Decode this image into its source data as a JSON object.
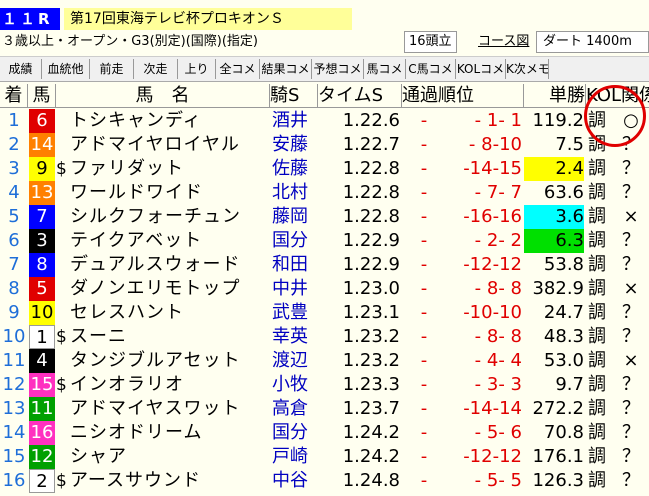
{
  "header": {
    "race_no": "１１R",
    "race_title": "第17回東海テレビ杯プロキオンＳ",
    "conditions": "３歳以上・オープン・G3(別定)(国際)(指定)",
    "heads": "16頭立",
    "course_link": "コース図",
    "track": "ダート 1400m"
  },
  "buttons": [
    "成績",
    "血統他",
    "前走",
    "次走",
    "上り",
    "全コメ",
    "結果コメ",
    "予想コメ",
    "馬コメ",
    "C馬コメ",
    "KOLコメ",
    "K次メモ"
  ],
  "columns": {
    "chaku": "着",
    "uma": "馬",
    "name": "馬　名",
    "jockey": "騎S",
    "time": "タイムS",
    "pass": "通過順位",
    "odds": "単勝",
    "kol": "KOL関係"
  },
  "colors": {
    "waku1": "#ffffff",
    "waku2": "#000000",
    "waku3": "#e00000",
    "waku4": "#0000ff",
    "waku5": "#ffff00",
    "waku6": "#00a000",
    "waku7": "#ff8000",
    "waku8": "#ff30c0",
    "fav1": "#ffff00",
    "fav2": "#00ffff",
    "fav3": "#00e000",
    "accent": "#e00000"
  },
  "rows": [
    {
      "chaku": "1",
      "waku": "3",
      "uma": "6",
      "mark": "",
      "name": "トシキャンディ",
      "jockey": "酒井",
      "time": "1.22.6",
      "dash": "-",
      "pass": "- 1- 1",
      "odds": "119.2",
      "cho": "調",
      "kol": "○",
      "fav": ""
    },
    {
      "chaku": "2",
      "waku": "7",
      "uma": "14",
      "mark": "",
      "name": "アドマイヤロイヤル",
      "jockey": "安藤",
      "time": "1.22.7",
      "dash": "-",
      "pass": "- 8-10",
      "odds": "7.5",
      "cho": "調",
      "kol": "？",
      "fav": ""
    },
    {
      "chaku": "3",
      "waku": "5",
      "uma": "9",
      "mark": "$",
      "name": "ファリダット",
      "jockey": "佐藤",
      "time": "1.22.8",
      "dash": "-",
      "pass": "-14-15",
      "odds": "2.4",
      "cho": "調",
      "kol": "？",
      "fav": "fav1"
    },
    {
      "chaku": "4",
      "waku": "7",
      "uma": "13",
      "mark": "",
      "name": "ワールドワイド",
      "jockey": "北村",
      "time": "1.22.8",
      "dash": "-",
      "pass": "- 7- 7",
      "odds": "63.6",
      "cho": "調",
      "kol": "？",
      "fav": ""
    },
    {
      "chaku": "5",
      "waku": "4",
      "uma": "7",
      "mark": "",
      "name": "シルクフォーチュン",
      "jockey": "藤岡",
      "time": "1.22.8",
      "dash": "-",
      "pass": "-16-16",
      "odds": "3.6",
      "cho": "調",
      "kol": "×",
      "fav": "fav2"
    },
    {
      "chaku": "6",
      "waku": "2",
      "uma": "3",
      "mark": "",
      "name": "テイクアベット",
      "jockey": "国分",
      "time": "1.22.9",
      "dash": "-",
      "pass": "- 2- 2",
      "odds": "6.3",
      "cho": "調",
      "kol": "？",
      "fav": "fav3"
    },
    {
      "chaku": "7",
      "waku": "4",
      "uma": "8",
      "mark": "",
      "name": "デュアルスウォード",
      "jockey": "和田",
      "time": "1.22.9",
      "dash": "-",
      "pass": "-12-12",
      "odds": "53.8",
      "cho": "調",
      "kol": "？",
      "fav": ""
    },
    {
      "chaku": "8",
      "waku": "3",
      "uma": "5",
      "mark": "",
      "name": "ダノンエリモトップ",
      "jockey": "中井",
      "time": "1.23.0",
      "dash": "-",
      "pass": "- 8- 8",
      "odds": "382.9",
      "cho": "調",
      "kol": "×",
      "fav": ""
    },
    {
      "chaku": "9",
      "waku": "5",
      "uma": "10",
      "mark": "",
      "name": "セレスハント",
      "jockey": "武豊",
      "time": "1.23.1",
      "dash": "-",
      "pass": "-10-10",
      "odds": "24.7",
      "cho": "調",
      "kol": "？",
      "fav": ""
    },
    {
      "chaku": "10",
      "waku": "1",
      "uma": "1",
      "mark": "$",
      "name": "スーニ",
      "jockey": "幸英",
      "time": "1.23.2",
      "dash": "-",
      "pass": "- 8- 8",
      "odds": "48.3",
      "cho": "調",
      "kol": "？",
      "fav": ""
    },
    {
      "chaku": "11",
      "waku": "2",
      "uma": "4",
      "mark": "",
      "name": "タンジブルアセット",
      "jockey": "渡辺",
      "time": "1.23.2",
      "dash": "-",
      "pass": "- 4- 4",
      "odds": "53.0",
      "cho": "調",
      "kol": "×",
      "fav": ""
    },
    {
      "chaku": "12",
      "waku": "8",
      "uma": "15",
      "mark": "$",
      "name": "インオラリオ",
      "jockey": "小牧",
      "time": "1.23.3",
      "dash": "-",
      "pass": "- 3- 3",
      "odds": "9.7",
      "cho": "調",
      "kol": "？",
      "fav": ""
    },
    {
      "chaku": "13",
      "waku": "6",
      "uma": "11",
      "mark": "",
      "name": "アドマイヤスワット",
      "jockey": "高倉",
      "time": "1.23.7",
      "dash": "-",
      "pass": "-14-14",
      "odds": "272.2",
      "cho": "調",
      "kol": "？",
      "fav": ""
    },
    {
      "chaku": "14",
      "waku": "8",
      "uma": "16",
      "mark": "",
      "name": "ニシオドリーム",
      "jockey": "国分",
      "time": "1.24.2",
      "dash": "-",
      "pass": "- 5- 6",
      "odds": "70.8",
      "cho": "調",
      "kol": "？",
      "fav": ""
    },
    {
      "chaku": "15",
      "waku": "6",
      "uma": "12",
      "mark": "",
      "name": "シャア",
      "jockey": "戸崎",
      "time": "1.24.2",
      "dash": "-",
      "pass": "-12-12",
      "odds": "176.1",
      "cho": "調",
      "kol": "？",
      "fav": ""
    },
    {
      "chaku": "16",
      "waku": "1",
      "uma": "2",
      "mark": "$",
      "name": "アースサウンド",
      "jockey": "中谷",
      "time": "1.24.8",
      "dash": "-",
      "pass": "- 5- 5",
      "odds": "126.3",
      "cho": "調",
      "kol": "？",
      "fav": ""
    }
  ]
}
